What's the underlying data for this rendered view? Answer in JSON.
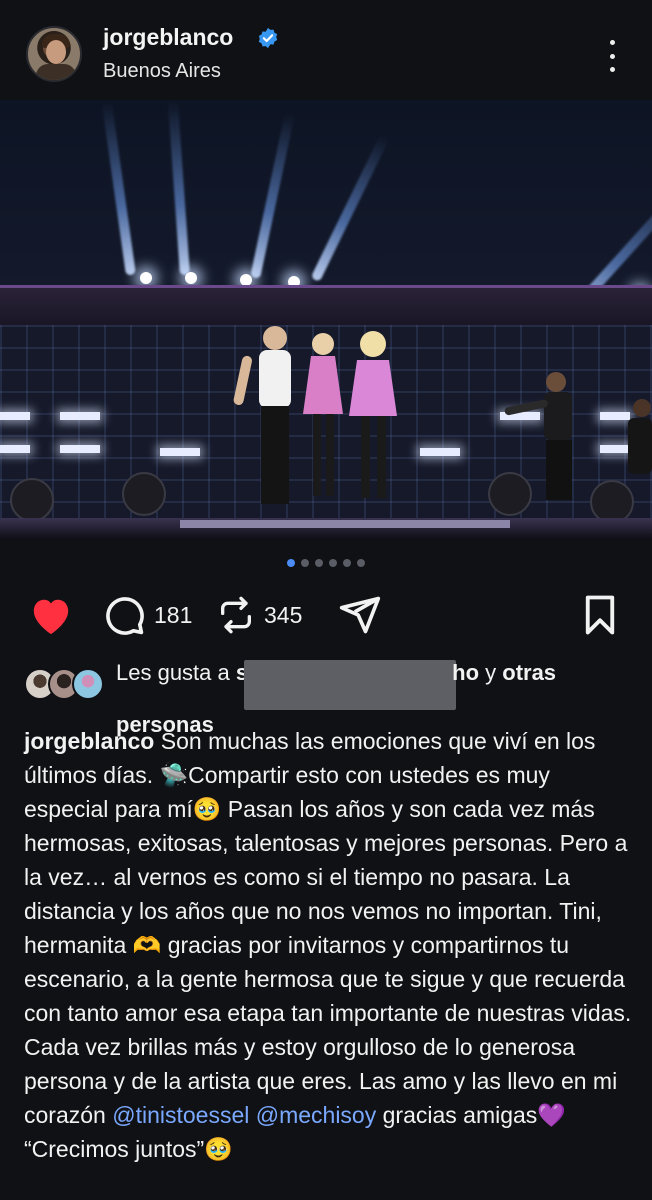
{
  "post": {
    "username": "jorgeblanco",
    "location": "Buenos Aires",
    "verified": true,
    "photo_alt_icon": "concert-photo",
    "carousel": {
      "total": 6,
      "active_index": 0
    }
  },
  "actions": {
    "like_icon": "heart-icon",
    "like_color": "#ff3040",
    "comments_count": "181",
    "reposts_count": "345",
    "share_icon": "send-icon",
    "save_icon": "bookmark-icon"
  },
  "likes": {
    "prefix": "Les gusta a ",
    "name_start": "s",
    "name_end": "ho",
    "connector": " y ",
    "others": "otras personas"
  },
  "caption": {
    "author": "jorgeblanco",
    "text_1": " Son muchas las emociones que viví en los últimos días. 🛸Compartir esto con ustedes es muy especial para mí🥹 Pasan los años y son cada vez más hermosas, exitosas, talentosas y mejores personas. Pero a la vez… al vernos es como si el tiempo no pasara.  La distancia y los años que no nos vemos no importan. Tini, hermanita 🫶 gracias por invitarnos y compartirnos tu escenario, a la gente hermosa que te sigue y que recuerda con tanto amor esa etapa tan importante de nuestras vidas. Cada vez brillas más y estoy orgulloso de lo generosa persona y de la artista que eres. Las amo y las llevo en mi corazón ",
    "mention_1": "@tinistoessel",
    "space": " ",
    "mention_2": "@mechisoy",
    "text_2": " gracias amigas💜 “Crecimos juntos”🥹"
  },
  "colors": {
    "background": "#101114",
    "text": "#f2f2f2",
    "mention": "#7aa8ff",
    "verified": "#3897f0",
    "carousel_active": "#4c8cf5"
  }
}
